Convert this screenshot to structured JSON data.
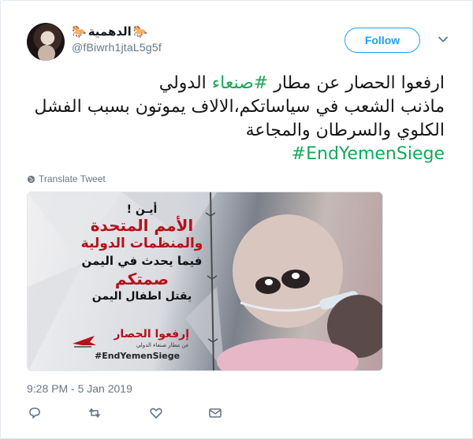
{
  "user": {
    "display_name": "الدهمية",
    "handle": "@fBiwrh1jtaL5g5f",
    "avatar_icon": "profile-photo"
  },
  "header": {
    "follow_label": "Follow",
    "menu_icon": "chevron-down-icon"
  },
  "tweet": {
    "line1_part1": "ارفعوا الحصار عن مطار ",
    "line1_hashtag": "#صنعاء",
    "line1_part2": " الدولي",
    "line2": "ماذنب الشعب في سياساتكم،الالاف يموتون بسبب الفشل",
    "line3": "الكلوي والسرطان والمجاعة",
    "hashtag": "#EndYemenSiege",
    "hashtag_color": "#16a85a"
  },
  "translate": {
    "label": "Translate Tweet",
    "icon": "globe-icon"
  },
  "media": {
    "text_1": "أيـن !",
    "text_2": "الأمم المتحدة",
    "text_3": "والمنظمات الدولية",
    "text_4": "فيما يحدث في اليمن",
    "text_5": "صمتكم",
    "text_6": "يقتل اطفال اليمن",
    "logo_title": "إرفعوا الحصار",
    "logo_subtitle": "عن مطار صنعاء الدولي",
    "logo_hashtag": "#EndYemenSiege",
    "accent": "#b3121a"
  },
  "meta": {
    "timestamp": "9:28 PM - 5 Jan 2019"
  },
  "actions": {
    "reply_icon": "reply-icon",
    "retweet_icon": "retweet-icon",
    "like_icon": "heart-icon",
    "message_icon": "message-icon"
  },
  "colors": {
    "brand_blue": "#1da1f2",
    "muted": "#657786",
    "text": "#14171a"
  }
}
